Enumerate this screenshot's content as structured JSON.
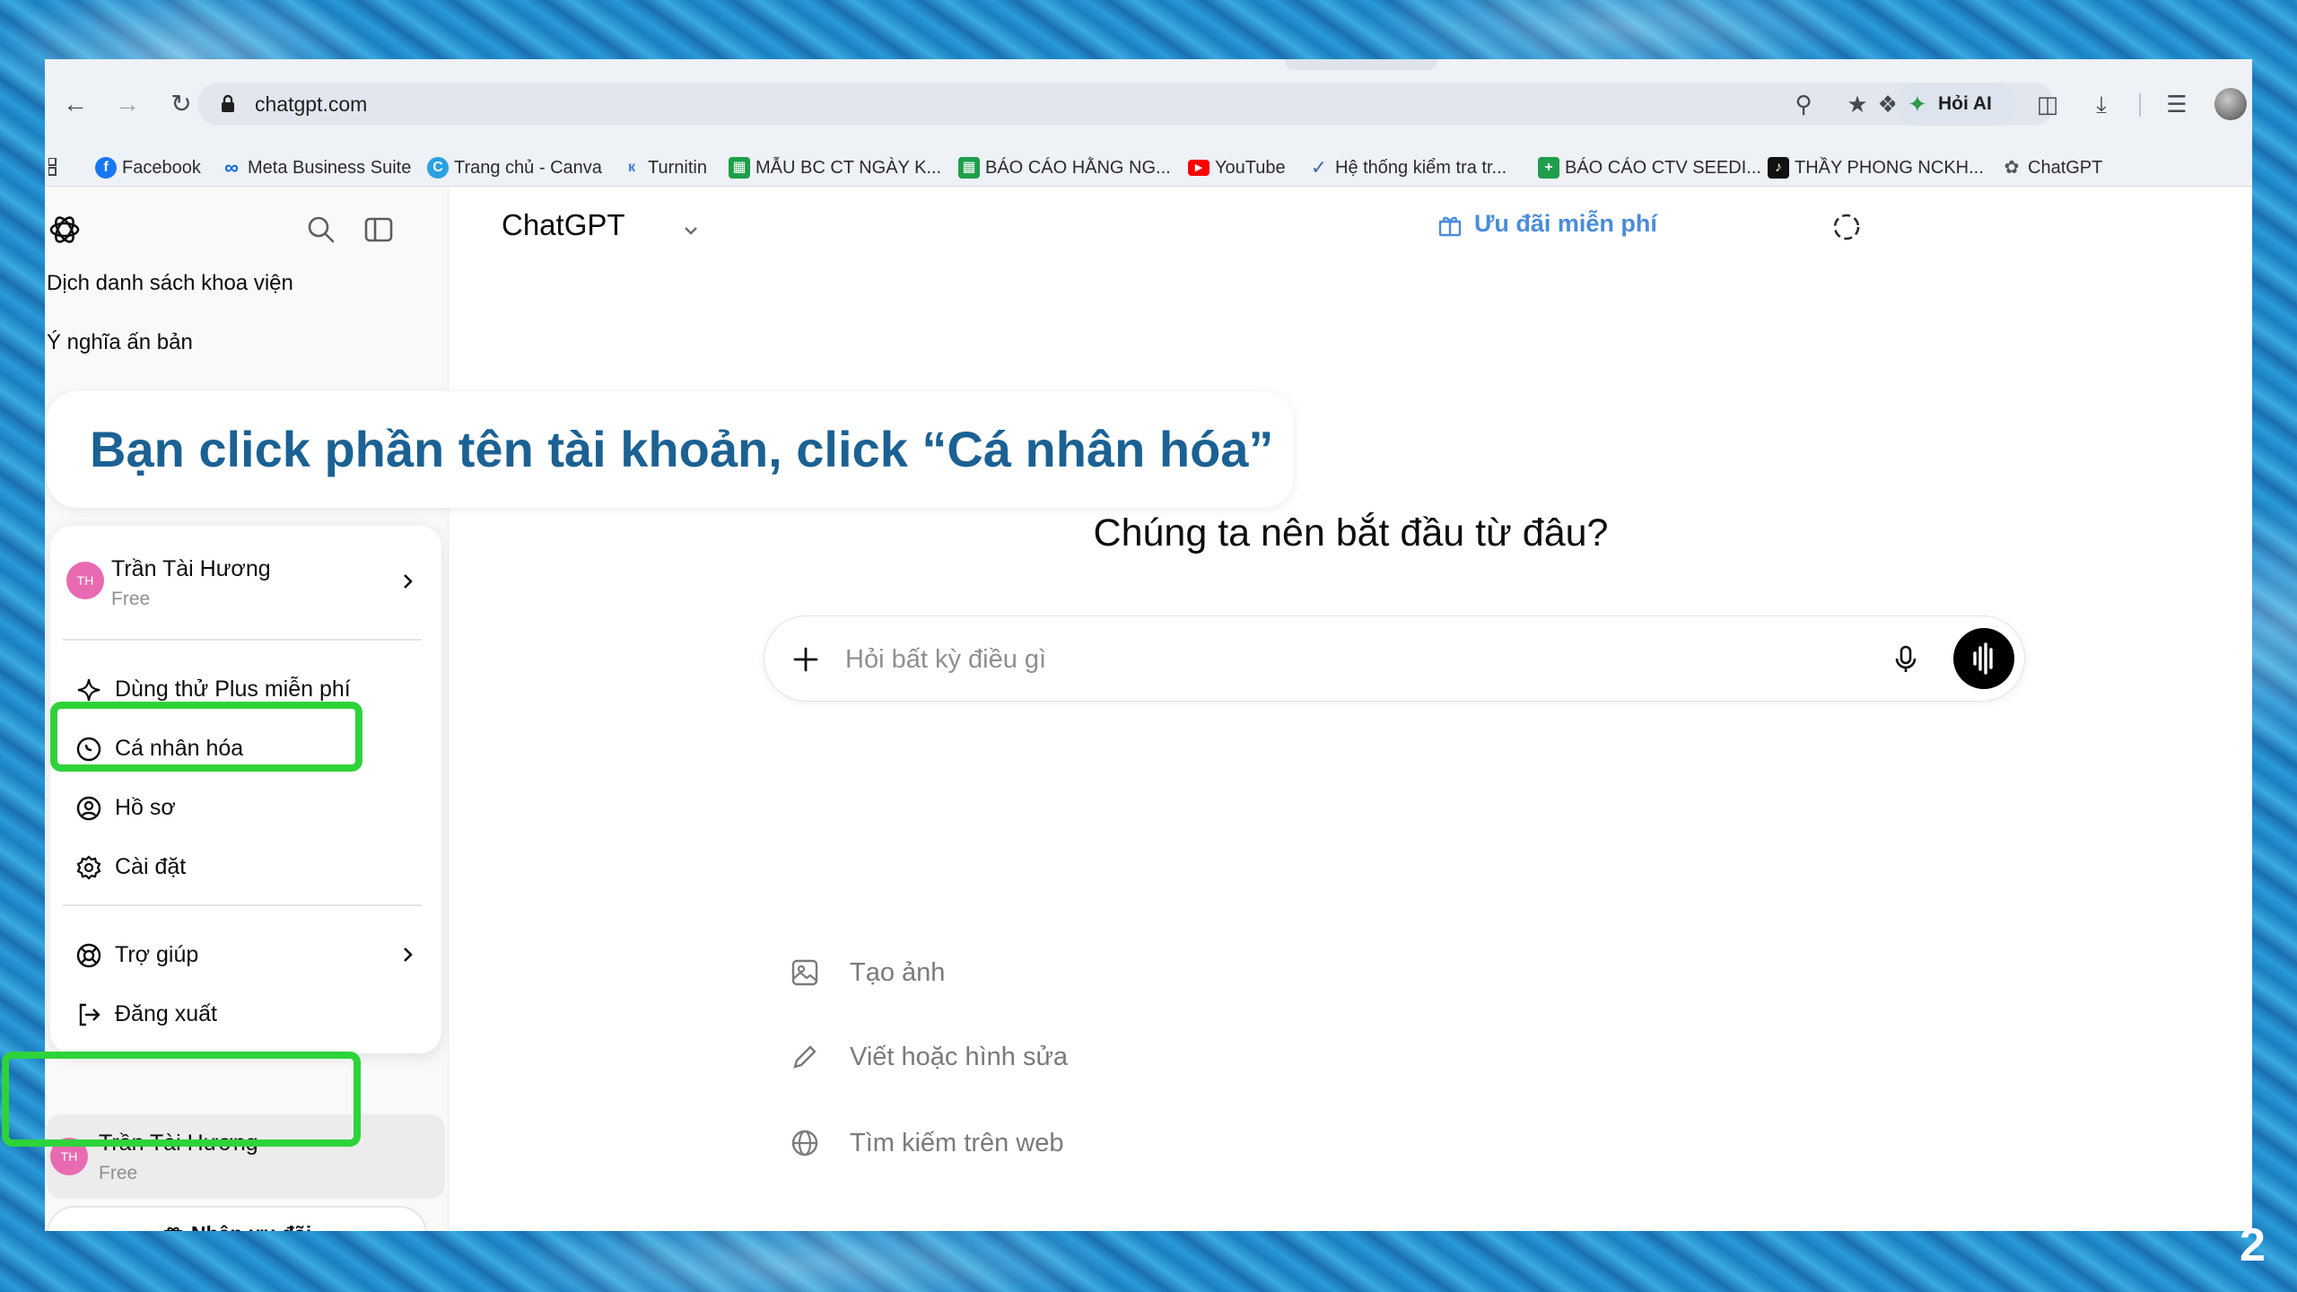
{
  "browser": {
    "url": "chatgpt.com",
    "ai_button": "Hỏi AI",
    "bookmarks": [
      {
        "label": "Facebook",
        "icon": "facebook-icon",
        "color": "#1877f2"
      },
      {
        "label": "Meta Business Suite",
        "icon": "meta-icon",
        "color": "#0668e1"
      },
      {
        "label": "Trang chủ - Canva",
        "icon": "canva-icon",
        "color": "#2aa1e0"
      },
      {
        "label": "Turnitin",
        "icon": "turnitin-icon",
        "color": "#3b7dd8"
      },
      {
        "label": "MẪU BC CT NGÀY K...",
        "icon": "sheet-icon",
        "color": "#1e9e4a"
      },
      {
        "label": "BÁO CÁO HẰNG NG...",
        "icon": "sheet-icon",
        "color": "#1e9e4a"
      },
      {
        "label": "YouTube",
        "icon": "youtube-icon",
        "color": "#ff0000"
      },
      {
        "label": "Hệ thống kiểm tra tr...",
        "icon": "check-icon",
        "color": "#3a6fa8"
      },
      {
        "label": "BÁO CÁO CTV SEEDI...",
        "icon": "plus-sheet-icon",
        "color": "#1e9e4a"
      },
      {
        "label": "THẦY PHONG NCKH...",
        "icon": "tiktok-icon",
        "color": "#111111"
      },
      {
        "label": "ChatGPT",
        "icon": "chatgpt-icon",
        "color": "#555555"
      }
    ]
  },
  "sidebar": {
    "history": [
      "Dịch danh sách khoa viện",
      "Ý nghĩa ấn bản"
    ],
    "user": {
      "initials": "TH",
      "name": "Trần Tài Hương",
      "plan": "Free"
    },
    "menu": {
      "items": [
        {
          "label": "Dùng thử Plus miễn phí",
          "icon": "sparkle-icon"
        },
        {
          "label": "Cá nhân hóa",
          "icon": "personalize-icon"
        },
        {
          "label": "Hồ sơ",
          "icon": "profile-icon"
        },
        {
          "label": "Cài đặt",
          "icon": "settings-icon"
        },
        {
          "label": "Trợ giúp",
          "icon": "help-icon"
        },
        {
          "label": "Đăng xuất",
          "icon": "logout-icon"
        }
      ]
    },
    "offer_button": "Nhận ưu đãi"
  },
  "main": {
    "model": "ChatGPT",
    "promo": "Ưu đãi miễn phí",
    "headline": "Chúng ta nên bắt đầu từ đâu?",
    "composer_placeholder": "Hỏi bất kỳ điều gì",
    "suggestions": [
      {
        "label": "Tạo ảnh",
        "icon": "image-icon"
      },
      {
        "label": "Viết hoặc hình sửa",
        "icon": "pencil-icon"
      },
      {
        "label": "Tìm kiếm trên web",
        "icon": "globe-icon"
      }
    ]
  },
  "overlay": {
    "callout": "Bạn click phần tên tài khoản, click “Cá nhân hóa”",
    "page_number": "2",
    "highlight_color": "#2ed33a"
  }
}
